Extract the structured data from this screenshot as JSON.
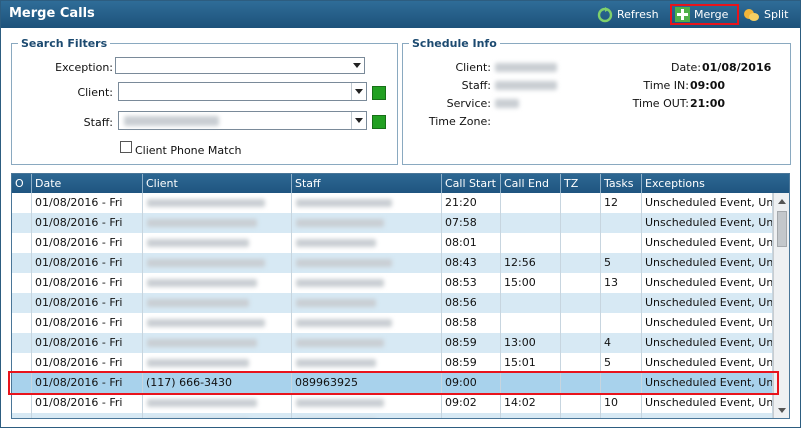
{
  "window": {
    "title": "Merge Calls"
  },
  "toolbar": {
    "refresh_label": "Refresh",
    "merge_label": "Merge",
    "split_label": "Split"
  },
  "search_filters": {
    "legend": "Search Filters",
    "exception_label": "Exception:",
    "exception_value": "",
    "client_label": "Client:",
    "client_value": "",
    "staff_label": "Staff:",
    "client_phone_match_label": "Client Phone Match",
    "client_phone_match_checked": false
  },
  "schedule_info": {
    "legend": "Schedule Info",
    "client_label": "Client:",
    "staff_label": "Staff:",
    "service_label": "Service:",
    "timezone_label": "Time Zone:",
    "date_label": "Date:",
    "date_value": "01/08/2016",
    "time_in_label": "Time IN:",
    "time_in_value": "09:00",
    "time_out_label": "Time OUT:",
    "time_out_value": "21:00"
  },
  "grid": {
    "columns": [
      "O",
      "Date",
      "Client",
      "Staff",
      "Call Start",
      "Call End",
      "TZ",
      "Tasks",
      "Exceptions"
    ],
    "rows": [
      {
        "date": "01/08/2016 - Fri",
        "client": "",
        "staff": "",
        "call_start": "21:20",
        "call_end": "",
        "tz": "",
        "tasks": "12",
        "exceptions": "Unscheduled Event, Un"
      },
      {
        "date": "01/08/2016 - Fri",
        "client": "",
        "staff": "",
        "call_start": "07:58",
        "call_end": "",
        "tz": "",
        "tasks": "",
        "exceptions": "Unscheduled Event, Un"
      },
      {
        "date": "01/08/2016 - Fri",
        "client": "",
        "staff": "",
        "call_start": "08:01",
        "call_end": "",
        "tz": "",
        "tasks": "",
        "exceptions": "Unscheduled Event, Un"
      },
      {
        "date": "01/08/2016 - Fri",
        "client": "",
        "staff": "",
        "call_start": "08:43",
        "call_end": "12:56",
        "tz": "",
        "tasks": "5",
        "exceptions": "Unscheduled Event, Un"
      },
      {
        "date": "01/08/2016 - Fri",
        "client": "",
        "staff": "",
        "call_start": "08:53",
        "call_end": "15:00",
        "tz": "",
        "tasks": "13",
        "exceptions": "Unscheduled Event, Un"
      },
      {
        "date": "01/08/2016 - Fri",
        "client": "",
        "staff": "",
        "call_start": "08:56",
        "call_end": "",
        "tz": "",
        "tasks": "",
        "exceptions": "Unscheduled Event, Un"
      },
      {
        "date": "01/08/2016 - Fri",
        "client": "",
        "staff": "",
        "call_start": "08:58",
        "call_end": "",
        "tz": "",
        "tasks": "",
        "exceptions": "Unscheduled Event, Un"
      },
      {
        "date": "01/08/2016 - Fri",
        "client": "",
        "staff": "",
        "call_start": "08:59",
        "call_end": "13:00",
        "tz": "",
        "tasks": "4",
        "exceptions": "Unscheduled Event, Un"
      },
      {
        "date": "01/08/2016 - Fri",
        "client": "",
        "staff": "",
        "call_start": "08:59",
        "call_end": "15:01",
        "tz": "",
        "tasks": "5",
        "exceptions": "Unscheduled Event, Un"
      },
      {
        "date": "01/08/2016 - Fri",
        "client": "(117) 666-3430",
        "staff": "089963925",
        "call_start": "09:00",
        "call_end": "",
        "tz": "",
        "tasks": "",
        "exceptions": "Unscheduled Event, Un"
      },
      {
        "date": "01/08/2016 - Fri",
        "client": "",
        "staff": "",
        "call_start": "09:02",
        "call_end": "14:02",
        "tz": "",
        "tasks": "10",
        "exceptions": "Unscheduled Event, Un"
      },
      {
        "date": "01/08/2016 - Fri",
        "client": "",
        "staff": "",
        "call_start": "",
        "call_end": "",
        "tz": "",
        "tasks": "",
        "exceptions": ""
      }
    ],
    "selected_row": 9
  },
  "colors": {
    "titlebar": "#1d527a",
    "row_alt": "#d7e9f4",
    "row_selected": "#a8d2ec",
    "highlight": "#e8141c",
    "status_green": "#22a022"
  }
}
